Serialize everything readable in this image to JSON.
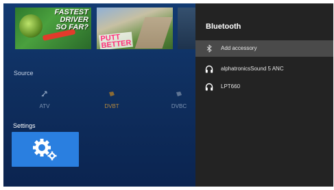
{
  "thumbnails": [
    {
      "text_line1": "FASTEST",
      "text_line2": "DRIVER",
      "text_line3": "SO FAR?"
    },
    {
      "text_line1": "PUTT",
      "text_line2": "BETTER"
    }
  ],
  "source": {
    "label": "Source",
    "items": [
      {
        "label": "ATV",
        "icon": "tv-antenna-icon",
        "active": false
      },
      {
        "label": "DVBT",
        "icon": "dvbt-icon",
        "active": true
      },
      {
        "label": "DVBC",
        "icon": "dvbc-icon",
        "active": false
      }
    ]
  },
  "settings": {
    "label": "Settings",
    "icon": "gear-icon"
  },
  "bluetooth_panel": {
    "title": "Bluetooth",
    "items": [
      {
        "label": "Add accessory",
        "icon": "bluetooth-icon",
        "selected": true
      },
      {
        "label": "alphatronicsSound 5 ANC",
        "icon": "headphones-icon",
        "selected": false
      },
      {
        "label": "LPT660",
        "icon": "headphones-icon",
        "selected": false
      }
    ]
  },
  "colors": {
    "background": "#123a72",
    "panel": "#232323",
    "selected_row": "#4a4a4a",
    "settings_tile": "#2a7fe0",
    "active_source": "#b88a3e"
  }
}
